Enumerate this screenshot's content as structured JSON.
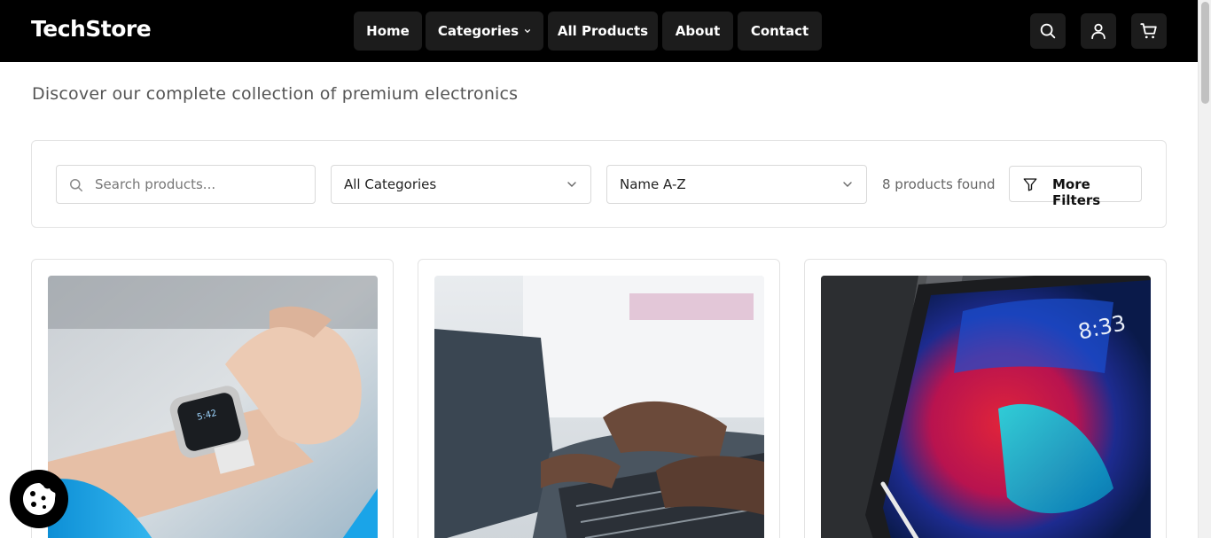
{
  "header": {
    "logo": "TechStore",
    "nav": [
      {
        "label": "Home"
      },
      {
        "label": "Categories"
      },
      {
        "label": "All Products"
      },
      {
        "label": "About"
      },
      {
        "label": "Contact"
      }
    ],
    "icons": [
      "search-icon",
      "user-icon",
      "cart-icon"
    ]
  },
  "main": {
    "subtitle": "Discover our complete collection of premium electronics"
  },
  "filters": {
    "search_placeholder": "Search products...",
    "category_value": "All Categories",
    "sort_value": "Name A-Z",
    "count_text": "8 products found",
    "more_filters_label": "More Filters"
  },
  "products": [
    {
      "image": "smartwatch-on-wrist"
    },
    {
      "image": "hands-typing-on-laptop"
    },
    {
      "image": "tablet-with-stylus"
    }
  ],
  "colors": {
    "header_bg": "#000000",
    "nav_item_bg": "#1c1c1c",
    "border": "#e3e3e3"
  }
}
